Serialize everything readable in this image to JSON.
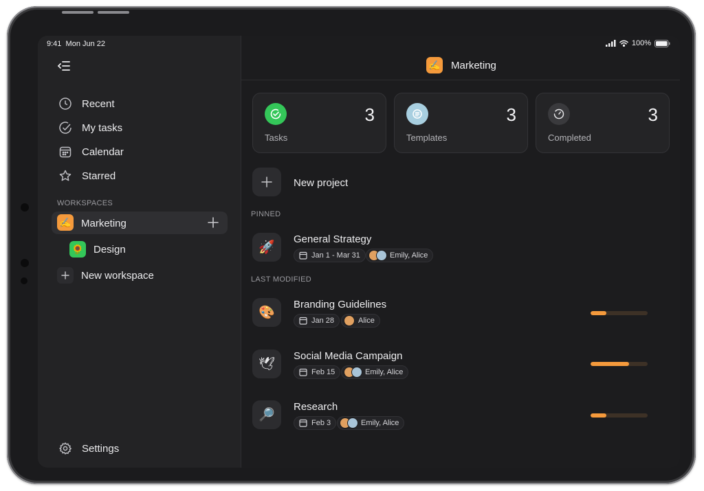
{
  "status": {
    "time": "9:41",
    "date": "Mon Jun 22",
    "battery": "100%"
  },
  "sidebar": {
    "nav": [
      {
        "label": "Recent",
        "icon": "clock-icon"
      },
      {
        "label": "My tasks",
        "icon": "check-circle-icon"
      },
      {
        "label": "Calendar",
        "icon": "calendar-icon"
      },
      {
        "label": "Starred",
        "icon": "star-icon"
      }
    ],
    "workspaces_label": "WORKSPACES",
    "workspaces": [
      {
        "label": "Marketing",
        "emoji": "✍",
        "color": "#f59a3c",
        "selected": true
      },
      {
        "label": "Design",
        "emoji": "🌻",
        "color": "#34c759"
      }
    ],
    "new_workspace": "New workspace",
    "settings": "Settings"
  },
  "header": {
    "title": "Marketing",
    "emoji": "✍",
    "color": "#f59a3c"
  },
  "stats": [
    {
      "label": "Tasks",
      "count": "3",
      "icon": "check-badge-icon",
      "color": "#34c759"
    },
    {
      "label": "Templates",
      "count": "3",
      "icon": "template-icon",
      "color": "#a8cfe0"
    },
    {
      "label": "Completed",
      "count": "3",
      "icon": "completed-clock-icon",
      "color": "#3a3a3d"
    }
  ],
  "new_project": "New project",
  "pinned_label": "PINNED",
  "last_modified_label": "LAST MODIFIED",
  "pinned": [
    {
      "title": "General Strategy",
      "emoji": "🚀",
      "date": "Jan 1 - Mar 31",
      "people": "Emily, Alice"
    }
  ],
  "recent": [
    {
      "title": "Branding Guidelines",
      "emoji": "🎨",
      "date": "Jan 28",
      "people": "Alice",
      "progress": 0.28
    },
    {
      "title": "Social Media Campaign",
      "emoji": "🕊",
      "date": "Feb 15",
      "people": "Emily, Alice",
      "progress": 0.68
    },
    {
      "title": "Research",
      "emoji": "🔎",
      "date": "Feb 3",
      "people": "Emily, Alice",
      "progress": 0.28
    }
  ],
  "colors": {
    "accent": "#f59a3c",
    "background": "#1c1c1e",
    "sidebar": "#232325"
  }
}
